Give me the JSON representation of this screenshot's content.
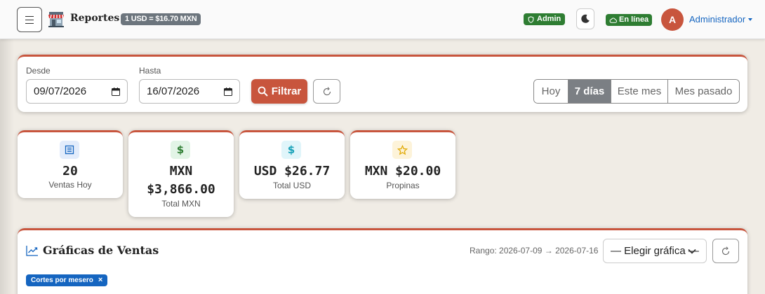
{
  "navbar": {
    "brand": "Reportes",
    "rate": "1 USD = $16.70 MXN",
    "admin_badge": "Admin",
    "status_badge": "En línea",
    "avatar_initial": "A",
    "user_name": "Administrador"
  },
  "filters": {
    "from_label": "Desde",
    "from_value": "09/07/2026",
    "to_label": "Hasta",
    "to_value": "16/07/2026",
    "filter_button": "Filtrar",
    "ranges": [
      {
        "label": "Hoy",
        "active": false
      },
      {
        "label": "7 días",
        "active": true
      },
      {
        "label": "Este mes",
        "active": false
      },
      {
        "label": "Mes pasado",
        "active": false
      }
    ]
  },
  "stats": [
    {
      "value": "20",
      "label": "Ventas Hoy",
      "icon": "receipt-icon",
      "icon_bg": "#e3ecfb",
      "icon_color": "#1565c0"
    },
    {
      "value": "MXN $3,866.00",
      "label": "Total MXN",
      "icon": "dollar-icon",
      "icon_bg": "#e2f4e6",
      "icon_color": "#2e7d32"
    },
    {
      "value": "USD $26.77",
      "label": "Total USD",
      "icon": "dollar-icon",
      "icon_bg": "#e0f5fa",
      "icon_color": "#17a2b8"
    },
    {
      "value": "MXN $20.00",
      "label": "Propinas",
      "icon": "star-icon",
      "icon_bg": "#fdf3d9",
      "icon_color": "#e0a800"
    }
  ],
  "charts": {
    "title": "Gráficas de Ventas",
    "range_text": "Rango: 2026-07-09 → 2026-07-16",
    "select_value": "— Elegir gráfica —",
    "active_tag": "Cortes por mesero",
    "tag_close": "×"
  },
  "colors": {
    "accent": "#c8553d",
    "success": "#2e7d32",
    "primary": "#1565c0",
    "secondary": "#6c757d"
  }
}
